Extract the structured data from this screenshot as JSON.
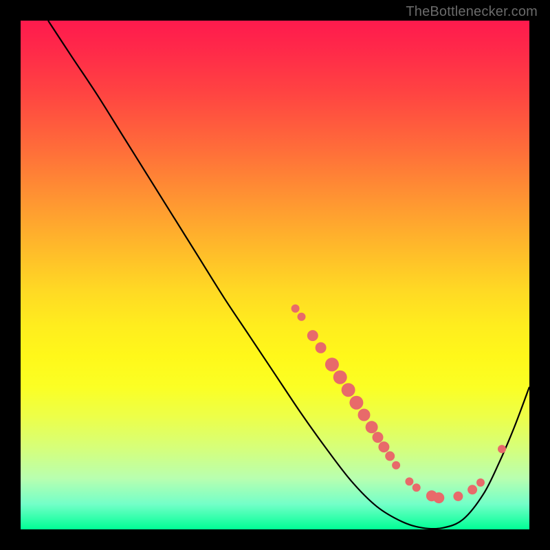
{
  "attribution": "TheBottlenecker.com",
  "chart_data": {
    "type": "line",
    "title": "",
    "xlabel": "",
    "ylabel": "",
    "ylim": [
      0,
      1
    ],
    "xlim": [
      0,
      1
    ],
    "curve_points": [
      {
        "x": 0.054,
        "y": 1.0
      },
      {
        "x": 0.1,
        "y": 0.93
      },
      {
        "x": 0.15,
        "y": 0.855
      },
      {
        "x": 0.2,
        "y": 0.775
      },
      {
        "x": 0.25,
        "y": 0.695
      },
      {
        "x": 0.3,
        "y": 0.615
      },
      {
        "x": 0.35,
        "y": 0.535
      },
      {
        "x": 0.4,
        "y": 0.455
      },
      {
        "x": 0.45,
        "y": 0.38
      },
      {
        "x": 0.5,
        "y": 0.305
      },
      {
        "x": 0.55,
        "y": 0.23
      },
      {
        "x": 0.6,
        "y": 0.16
      },
      {
        "x": 0.65,
        "y": 0.095
      },
      {
        "x": 0.7,
        "y": 0.045
      },
      {
        "x": 0.75,
        "y": 0.015
      },
      {
        "x": 0.79,
        "y": 0.003
      },
      {
        "x": 0.83,
        "y": 0.003
      },
      {
        "x": 0.87,
        "y": 0.02
      },
      {
        "x": 0.91,
        "y": 0.07
      },
      {
        "x": 0.94,
        "y": 0.13
      },
      {
        "x": 0.97,
        "y": 0.2
      },
      {
        "x": 1.0,
        "y": 0.28
      }
    ],
    "markers": [
      {
        "x": 0.54,
        "y": 0.434,
        "r": 6
      },
      {
        "x": 0.552,
        "y": 0.418,
        "r": 6
      },
      {
        "x": 0.574,
        "y": 0.381,
        "r": 8
      },
      {
        "x": 0.59,
        "y": 0.357,
        "r": 8
      },
      {
        "x": 0.612,
        "y": 0.324,
        "r": 10
      },
      {
        "x": 0.628,
        "y": 0.299,
        "r": 10
      },
      {
        "x": 0.644,
        "y": 0.274,
        "r": 10
      },
      {
        "x": 0.66,
        "y": 0.249,
        "r": 10
      },
      {
        "x": 0.675,
        "y": 0.225,
        "r": 9
      },
      {
        "x": 0.69,
        "y": 0.201,
        "r": 9
      },
      {
        "x": 0.702,
        "y": 0.181,
        "r": 8
      },
      {
        "x": 0.714,
        "y": 0.162,
        "r": 8
      },
      {
        "x": 0.726,
        "y": 0.144,
        "r": 7
      },
      {
        "x": 0.738,
        "y": 0.126,
        "r": 6
      },
      {
        "x": 0.764,
        "y": 0.094,
        "r": 6
      },
      {
        "x": 0.778,
        "y": 0.082,
        "r": 6
      },
      {
        "x": 0.808,
        "y": 0.066,
        "r": 8
      },
      {
        "x": 0.822,
        "y": 0.062,
        "r": 8
      },
      {
        "x": 0.86,
        "y": 0.065,
        "r": 7
      },
      {
        "x": 0.888,
        "y": 0.078,
        "r": 7
      },
      {
        "x": 0.904,
        "y": 0.092,
        "r": 6
      },
      {
        "x": 0.946,
        "y": 0.158,
        "r": 6
      }
    ],
    "colors": {
      "curve": "#000000",
      "marker_fill": "#e86a6a",
      "marker_stroke": "#c94f4f"
    }
  }
}
